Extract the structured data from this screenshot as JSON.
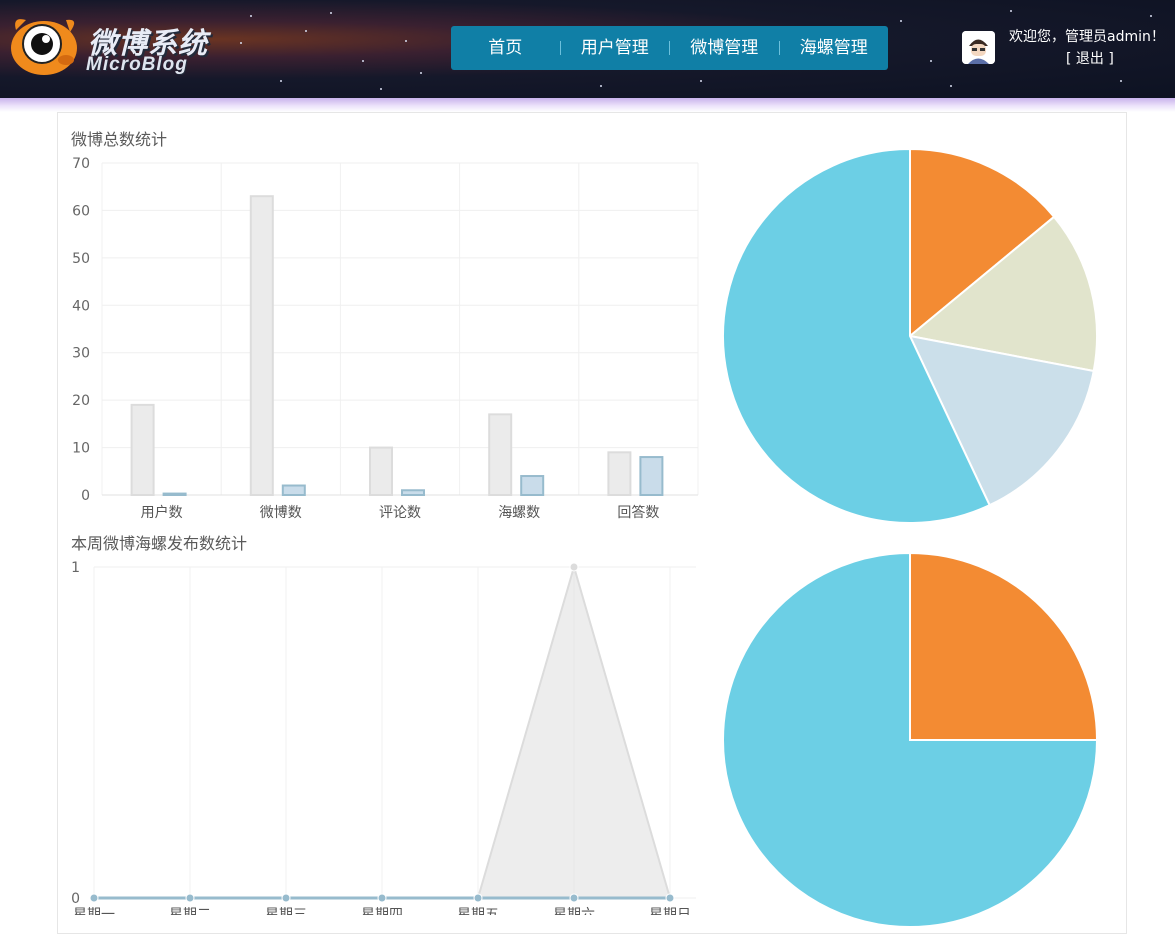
{
  "app": {
    "logo_cn": "微博系统",
    "logo_en": "MicroBlog"
  },
  "nav": {
    "items": [
      {
        "label": "首页"
      },
      {
        "label": "用户管理"
      },
      {
        "label": "微博管理"
      },
      {
        "label": "海螺管理"
      }
    ]
  },
  "user": {
    "welcome": "欢迎您，管理员admin！",
    "logout": "[ 退出 ]"
  },
  "colors": {
    "nav_bg": "#107fa6",
    "bar_gray": "#ebebeb",
    "bar_blue": "#c9dcea",
    "pie_orange": "#f38b33",
    "pie_beige": "#e1e4cc",
    "pie_lightblue": "#cbdfea",
    "pie_cyan": "#6ccfe5"
  },
  "chart_data": [
    {
      "type": "bar",
      "title": "微博总数统计",
      "categories": [
        "用户数",
        "微博数",
        "评论数",
        "海螺数",
        "回答数"
      ],
      "series": [
        {
          "values": [
            19,
            63,
            10,
            17,
            9
          ]
        },
        {
          "values": [
            0.3,
            2,
            1,
            4,
            8
          ]
        }
      ],
      "ylim": [
        0,
        70
      ],
      "yticks": [
        "0",
        "10",
        "20",
        "30",
        "40",
        "50",
        "60",
        "70"
      ],
      "grid": true
    },
    {
      "type": "pie",
      "values": [
        14,
        14,
        15,
        57
      ],
      "colors": [
        "#f38b33",
        "#e1e4cc",
        "#cbdfea",
        "#6ccfe5"
      ]
    },
    {
      "type": "line",
      "title": "本周微博海螺发布数统计",
      "x": [
        "星期一",
        "星期二",
        "星期三",
        "星期四",
        "星期五",
        "星期六",
        "星期日"
      ],
      "series": [
        {
          "values": [
            0,
            0,
            0,
            0,
            0,
            1,
            0
          ]
        },
        {
          "values": [
            0,
            0,
            0,
            0,
            0,
            0,
            0
          ]
        }
      ],
      "ylim": [
        0,
        1
      ],
      "yticks": [
        "0",
        "1"
      ],
      "grid": true
    },
    {
      "type": "pie",
      "values": [
        25,
        75
      ],
      "colors": [
        "#f38b33",
        "#6ccfe5"
      ]
    }
  ]
}
